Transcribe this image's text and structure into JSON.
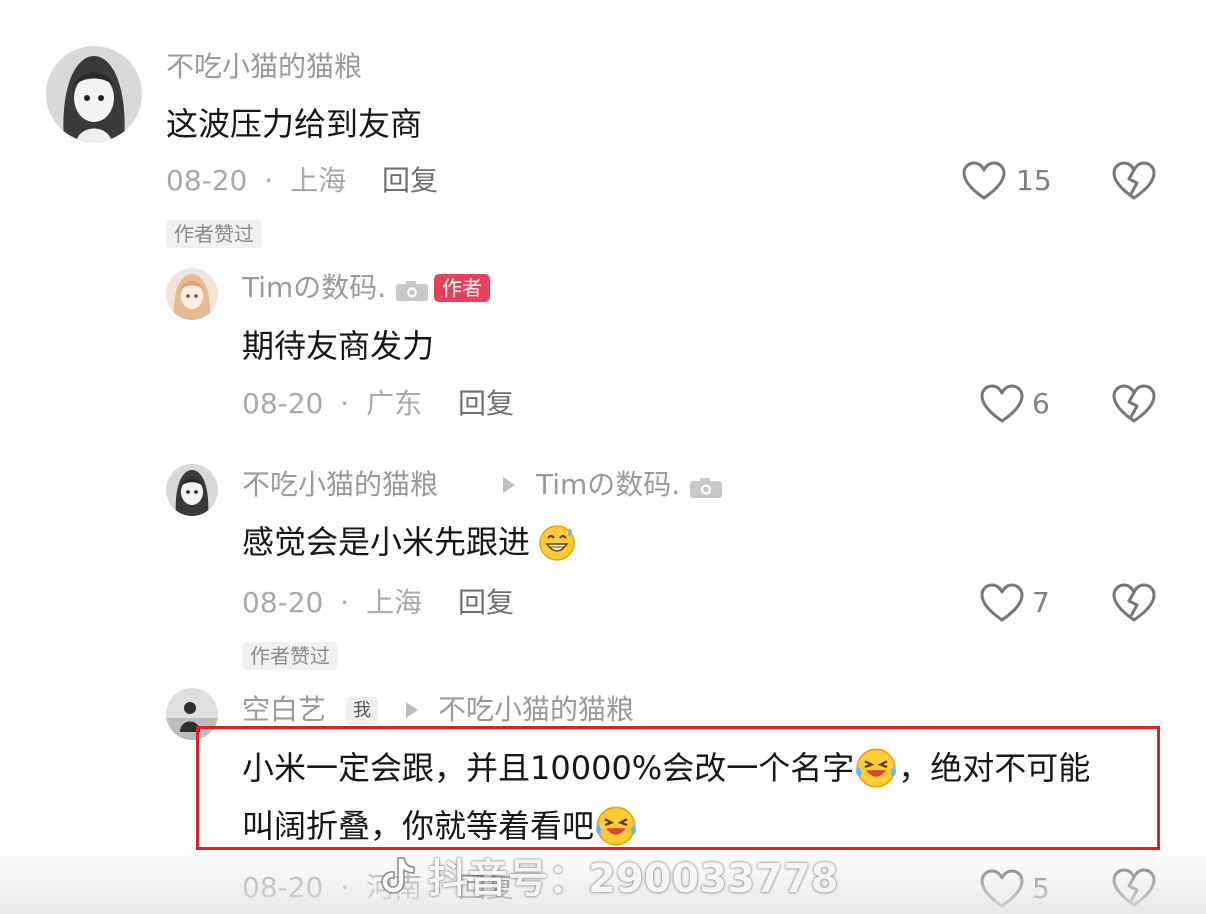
{
  "comments": [
    {
      "username": "不吃小猫的猫粮",
      "text": "这波压力给到友商",
      "date": "08-20",
      "location": "上海",
      "reply_label": "回复",
      "likes": "15",
      "badge": "作者赞过"
    },
    {
      "username": "Timの数码.",
      "author_tag": "作者",
      "text": "期待友商发力",
      "date": "08-20",
      "location": "广东",
      "reply_label": "回复",
      "likes": "6"
    },
    {
      "username": "不吃小猫的猫粮",
      "reply_to": "Timの数码.",
      "text": "感觉会是小米先跟进",
      "emoji": "grin-sweat-emoji",
      "date": "08-20",
      "location": "上海",
      "reply_label": "回复",
      "likes": "7",
      "badge": "作者赞过"
    },
    {
      "username": "空白艺",
      "me_tag": "我",
      "reply_to": "不吃小猫的猫粮",
      "text_line1_a": "小米一定会跟，并且10000%会改一个名字",
      "text_line1_b": "，绝对不可能",
      "text_line2": "叫阔折叠，你就等着看吧",
      "emoji": "laugh-cry-emoji",
      "date": "08-20",
      "location": "河南",
      "reply_label": "回复",
      "likes": "5"
    }
  ],
  "separator": "·",
  "watermark": "抖音号：290033778",
  "colors": {
    "author_tag": "#e8405a",
    "highlight_border": "#e02020",
    "text_primary": "#161616",
    "text_secondary": "#9a9a9a"
  }
}
